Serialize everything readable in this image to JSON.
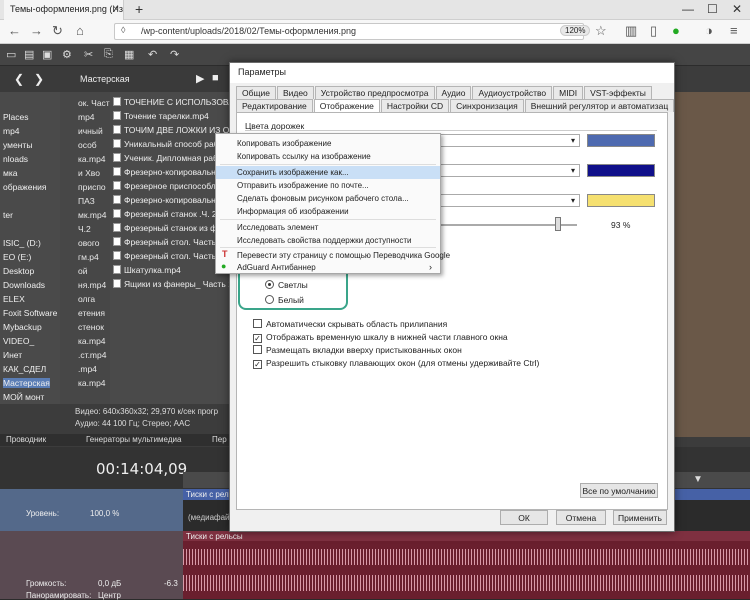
{
  "browser": {
    "tab_title": "Темы-оформления.png (Изобра",
    "tab_close": "×",
    "new_tab": "+",
    "min": "—",
    "max": "☐",
    "close": "✕",
    "url": "/wp-content/uploads/2018/02/Темы-оформления.png",
    "zoom": "120%"
  },
  "left_tree": [
    "Places",
    "mp4",
    "ументы",
    "nloads",
    "мка",
    "ображения",
    "ter",
    "ISIC_ (D:)",
    "EO (E:)",
    "Desktop",
    "Downloads",
    "ELEX",
    "Foxit Software",
    "Mybackup",
    "VIDEO_",
    "Инет",
    "КАК_СДЕЛ",
    "Мастерская",
    "МОЙ монт"
  ],
  "mid_list": [
    "ок. Част",
    "mp4",
    "ичный",
    "особ",
    "ка.mp4",
    "и Хво",
    "приспо",
    "ПАЗ",
    "мк.mp4",
    "Ч.2",
    "ового",
    "гм.p4",
    "ой",
    "ня.mp4",
    "олга",
    "етения",
    "стенок",
    "ка.mp4",
    ".ст.mp4",
    ".mp4",
    "ка.mp4"
  ],
  "folder_label": "Мастерская",
  "files": [
    "ТОЧЕНИЕ С ИСПОЛЬЗОВА",
    "Точение тарелки.mp4",
    "ТОЧИМ ДВЕ ЛОЖКИ ИЗ О",
    "Уникальный способ раб",
    "Ученик. Дипломная рабо",
    "Фрезерно-копировальн",
    "Фрезерное приспособл",
    "Фрезерно-копировальн",
    "Фрезерный станок .Ч. 2",
    "Фрезерный станок из ф",
    "Фрезерный стол. Часть",
    "Фрезерный стол. Часть",
    "Шкатулка.mp4",
    "Ящики из фанеры_ Часть 1"
  ],
  "info": {
    "line1": "Видео: 640x360x32; 29,970 к/сек прогр",
    "line2": "Аудио: 44 100 Гц; Стерео; AAC"
  },
  "dock_tabs": [
    "Проводник",
    "Генераторы мультимедиа",
    "Пер"
  ],
  "timeline": {
    "timecode": "00:14:04,09",
    "track1_label": "Уровень:",
    "track1_value": "100,0 %",
    "track2_volume_label": "Громкость:",
    "track2_volume_value": "0,0 дБ",
    "track2_pan_label": "Панорамировать:",
    "track2_pan_value": "Центр",
    "clip_title": "Тиски с рельсы",
    "clip_sub": "(медиафайл не найден)",
    "audio_clip_title": "Тиски с рельсы",
    "db_label": "-6.3"
  },
  "dialog": {
    "title": "Параметры",
    "tabs_row1": [
      "Общие",
      "Видео",
      "Устройство предпросмотра",
      "Аудио",
      "Аудиоустройство",
      "MIDI",
      "VST-эффекты"
    ],
    "tabs_row2": [
      "Редактирование",
      "Отображение",
      "Настройки CD",
      "Синхронизация",
      "Внешний регулятор и автоматизац"
    ],
    "section_label": "Цвета дорожек",
    "percent": "93 %",
    "radio_light": "Светлы",
    "radio_white": "Белый",
    "checkboxes": [
      {
        "label": "Автоматически скрывать область прилипания",
        "checked": false
      },
      {
        "label": "Отображать временную шкалу в нижней части главного окна",
        "checked": true
      },
      {
        "label": "Размещать вкладки вверху пристыкованных окон",
        "checked": false
      },
      {
        "label": "Разрешить стыковку плавающих окон (для отмены удерживайте Ctrl)",
        "checked": true
      }
    ],
    "btn_default": "Все по умолчанию",
    "btn_ok": "ОК",
    "btn_cancel": "Отмена",
    "btn_apply": "Применить",
    "colors": {
      "swatch1": "#4e6ab0",
      "swatch2": "#10108a",
      "swatch3": "#f5e070"
    }
  },
  "context_menu": {
    "items": [
      "Копировать изображение",
      "Копировать ссылку на изображение",
      "Сохранить изображение как...",
      "Отправить изображение по почте...",
      "Сделать фоновым рисунком рабочего стола...",
      "Информация об изображении",
      "Исследовать элемент",
      "Исследовать свойства поддержки доступности",
      "Перевести эту страницу с помощью Переводчика Google",
      "AdGuard Антибаннер"
    ],
    "arrow": "›"
  }
}
